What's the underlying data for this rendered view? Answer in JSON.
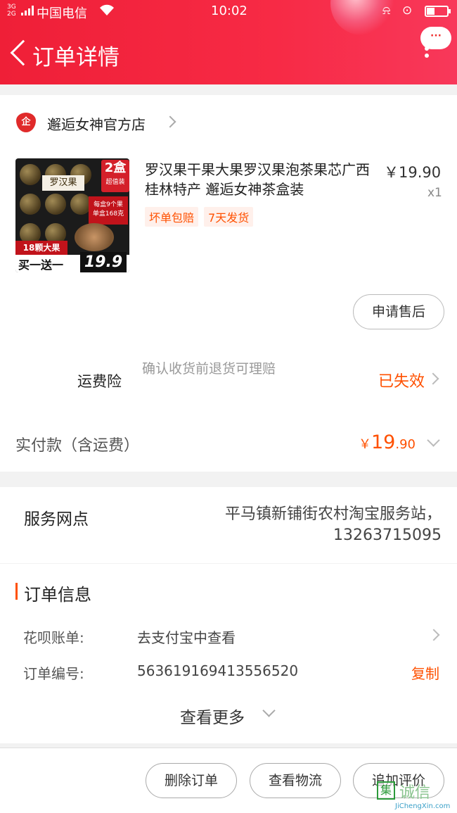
{
  "status_bar": {
    "network": "3G 2G",
    "carrier": "中国电信",
    "time": "10:02",
    "icons": [
      "vibrate-icon",
      "lock-rotation-icon",
      "battery-icon"
    ]
  },
  "header": {
    "title": "订单详情",
    "more_label": "···",
    "color": "#f2203b"
  },
  "shop": {
    "logo_text": "企",
    "name": "邂逅女神官方店"
  },
  "product": {
    "title": "罗汉果干果大果罗汉果泡茶果芯广西桂林特产 邂逅女神茶盒装",
    "price": "￥19.90",
    "quantity": "x1",
    "tags": [
      "坏单包赔",
      "7天发货"
    ],
    "image": {
      "box_label": "罗汉果",
      "badge_big": "2盒",
      "badge_small": "超值装",
      "side_text_1": "每盒9个果",
      "side_text_2": "单盒168克",
      "strip_red": "18颗大果",
      "strip_white": "买一送一",
      "strip_price": "19.9"
    },
    "after_sale_button": "申请售后"
  },
  "insurance": {
    "label": "运费险",
    "description": "确认收货前退货可理赔",
    "status": "已失效"
  },
  "payment": {
    "label": "实付款（含运费）",
    "currency": "￥",
    "integer": "19",
    "decimal": ".90"
  },
  "service": {
    "label": "服务网点",
    "value": "平马镇新铺街农村淘宝服务站，13263715095"
  },
  "order_info": {
    "heading": "订单信息",
    "rows": [
      {
        "key": "花呗账单:",
        "value": "去支付宝中查看"
      },
      {
        "key": "订单编号:",
        "value": "563619169413556520",
        "action": "复制"
      }
    ],
    "see_more": "查看更多"
  },
  "bottom_bar": {
    "buttons": [
      "删除订单",
      "查看物流",
      "追加评价"
    ]
  },
  "watermark": {
    "icon_text": "集",
    "text": "诚信",
    "url": "JiChengXin.com"
  },
  "colors": {
    "accent": "#ff5000",
    "header_red": "#f2203b"
  }
}
